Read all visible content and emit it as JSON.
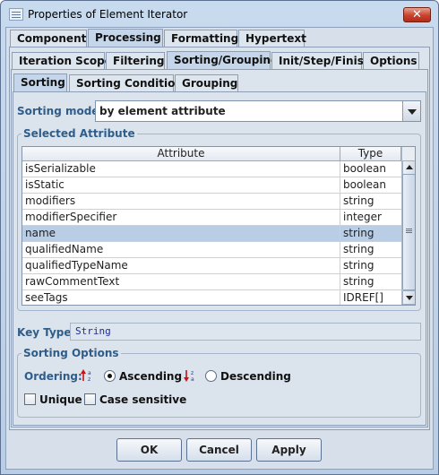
{
  "window": {
    "title": "Properties of Element Iterator",
    "close_glyph": "✕"
  },
  "top_tabs": [
    {
      "label": "Component",
      "selected": false
    },
    {
      "label": "Processing",
      "selected": true
    },
    {
      "label": "Formatting",
      "selected": false
    },
    {
      "label": "Hypertext",
      "selected": false
    }
  ],
  "second_tabs": [
    {
      "label": "Iteration Scope",
      "selected": false
    },
    {
      "label": "Filtering",
      "selected": false
    },
    {
      "label": "Sorting/Grouping",
      "selected": true
    },
    {
      "label": "Init/Step/Finish",
      "selected": false
    },
    {
      "label": "Options",
      "selected": false
    }
  ],
  "third_tabs": [
    {
      "label": "Sorting",
      "selected": true
    },
    {
      "label": "Sorting Condition",
      "selected": false
    },
    {
      "label": "Grouping",
      "selected": false
    }
  ],
  "sorting_mode": {
    "label": "Sorting mode:",
    "value": "by element attribute"
  },
  "selected_attribute": {
    "title": "Selected Attribute",
    "columns": [
      "Attribute",
      "Type"
    ],
    "rows": [
      {
        "attribute": "isSerializable",
        "type": "boolean",
        "selected": false
      },
      {
        "attribute": "isStatic",
        "type": "boolean",
        "selected": false
      },
      {
        "attribute": "modifiers",
        "type": "string",
        "selected": false
      },
      {
        "attribute": "modifierSpecifier",
        "type": "integer",
        "selected": false
      },
      {
        "attribute": "name",
        "type": "string",
        "selected": true
      },
      {
        "attribute": "qualifiedName",
        "type": "string",
        "selected": false
      },
      {
        "attribute": "qualifiedTypeName",
        "type": "string",
        "selected": false
      },
      {
        "attribute": "rawCommentText",
        "type": "string",
        "selected": false
      },
      {
        "attribute": "seeTags",
        "type": "IDREF[]",
        "selected": false
      }
    ]
  },
  "key_type": {
    "label": "Key Type:",
    "value": "String"
  },
  "sorting_options": {
    "title": "Sorting Options",
    "ordering_label": "Ordering:",
    "ascending_label": "Ascending",
    "descending_label": "Descending",
    "ordering_value": "Ascending",
    "unique_label": "Unique",
    "unique_checked": false,
    "case_sensitive_label": "Case sensitive",
    "case_sensitive_checked": false
  },
  "buttons": {
    "ok": "OK",
    "cancel": "Cancel",
    "apply": "Apply"
  },
  "colors": {
    "accent_label": "#2f5d8a",
    "selection": "#b9cde5",
    "sort_icon_red": "#cc1111",
    "key_text": "#1c2c9c"
  }
}
